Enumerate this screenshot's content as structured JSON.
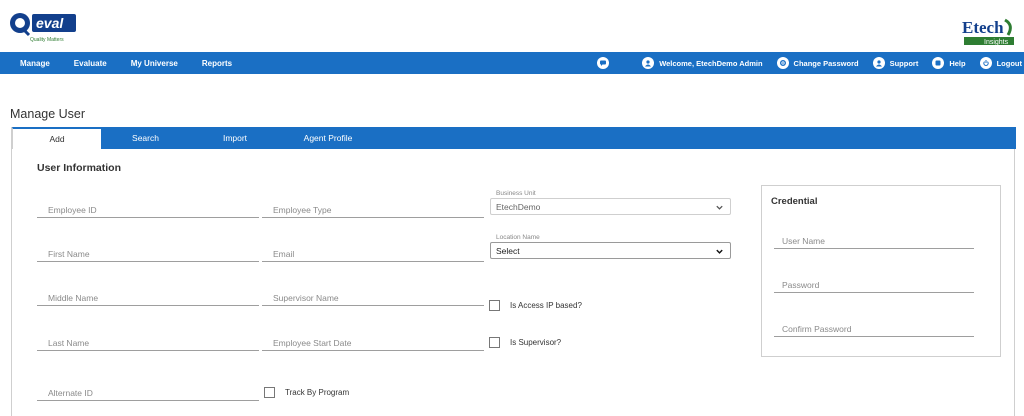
{
  "branding": {
    "qeval_logo_text": "QEval",
    "qeval_tagline": "Quality Matters",
    "etech_logo_text": "Etech",
    "etech_logo_sub": "Insights"
  },
  "nav": {
    "left": [
      "Manage",
      "Evaluate",
      "My Universe",
      "Reports"
    ],
    "right": {
      "welcome": "Welcome, EtechDemo Admin",
      "change_password": "Change Password",
      "support": "Support",
      "help": "Help",
      "logout": "Logout"
    }
  },
  "page_title": "Manage User",
  "tabs": [
    "Add",
    "Search",
    "Import",
    "Agent Profile"
  ],
  "section_title": "User Information",
  "fields": {
    "employee_id": "Employee ID",
    "employee_type": "Employee Type",
    "first_name": "First Name",
    "email": "Email",
    "middle_name": "Middle Name",
    "supervisor_name": "Supervisor Name",
    "last_name": "Last Name",
    "employee_start_date": "Employee Start Date",
    "alternate_id": "Alternate ID"
  },
  "business_unit": {
    "label": "Business Unit",
    "value": "EtechDemo"
  },
  "location_name": {
    "label": "Location Name",
    "value": "Select"
  },
  "checkboxes": {
    "access_ip": "Is Access IP based?",
    "supervisor": "Is Supervisor?",
    "track_by_program": "Track By Program"
  },
  "credential": {
    "title": "Credential",
    "user_name": "User Name",
    "password": "Password",
    "confirm_password": "Confirm Password"
  },
  "colors": {
    "primary": "#1a6fc4",
    "logo_blue": "#123f8c",
    "logo_green": "#2e7d32"
  }
}
